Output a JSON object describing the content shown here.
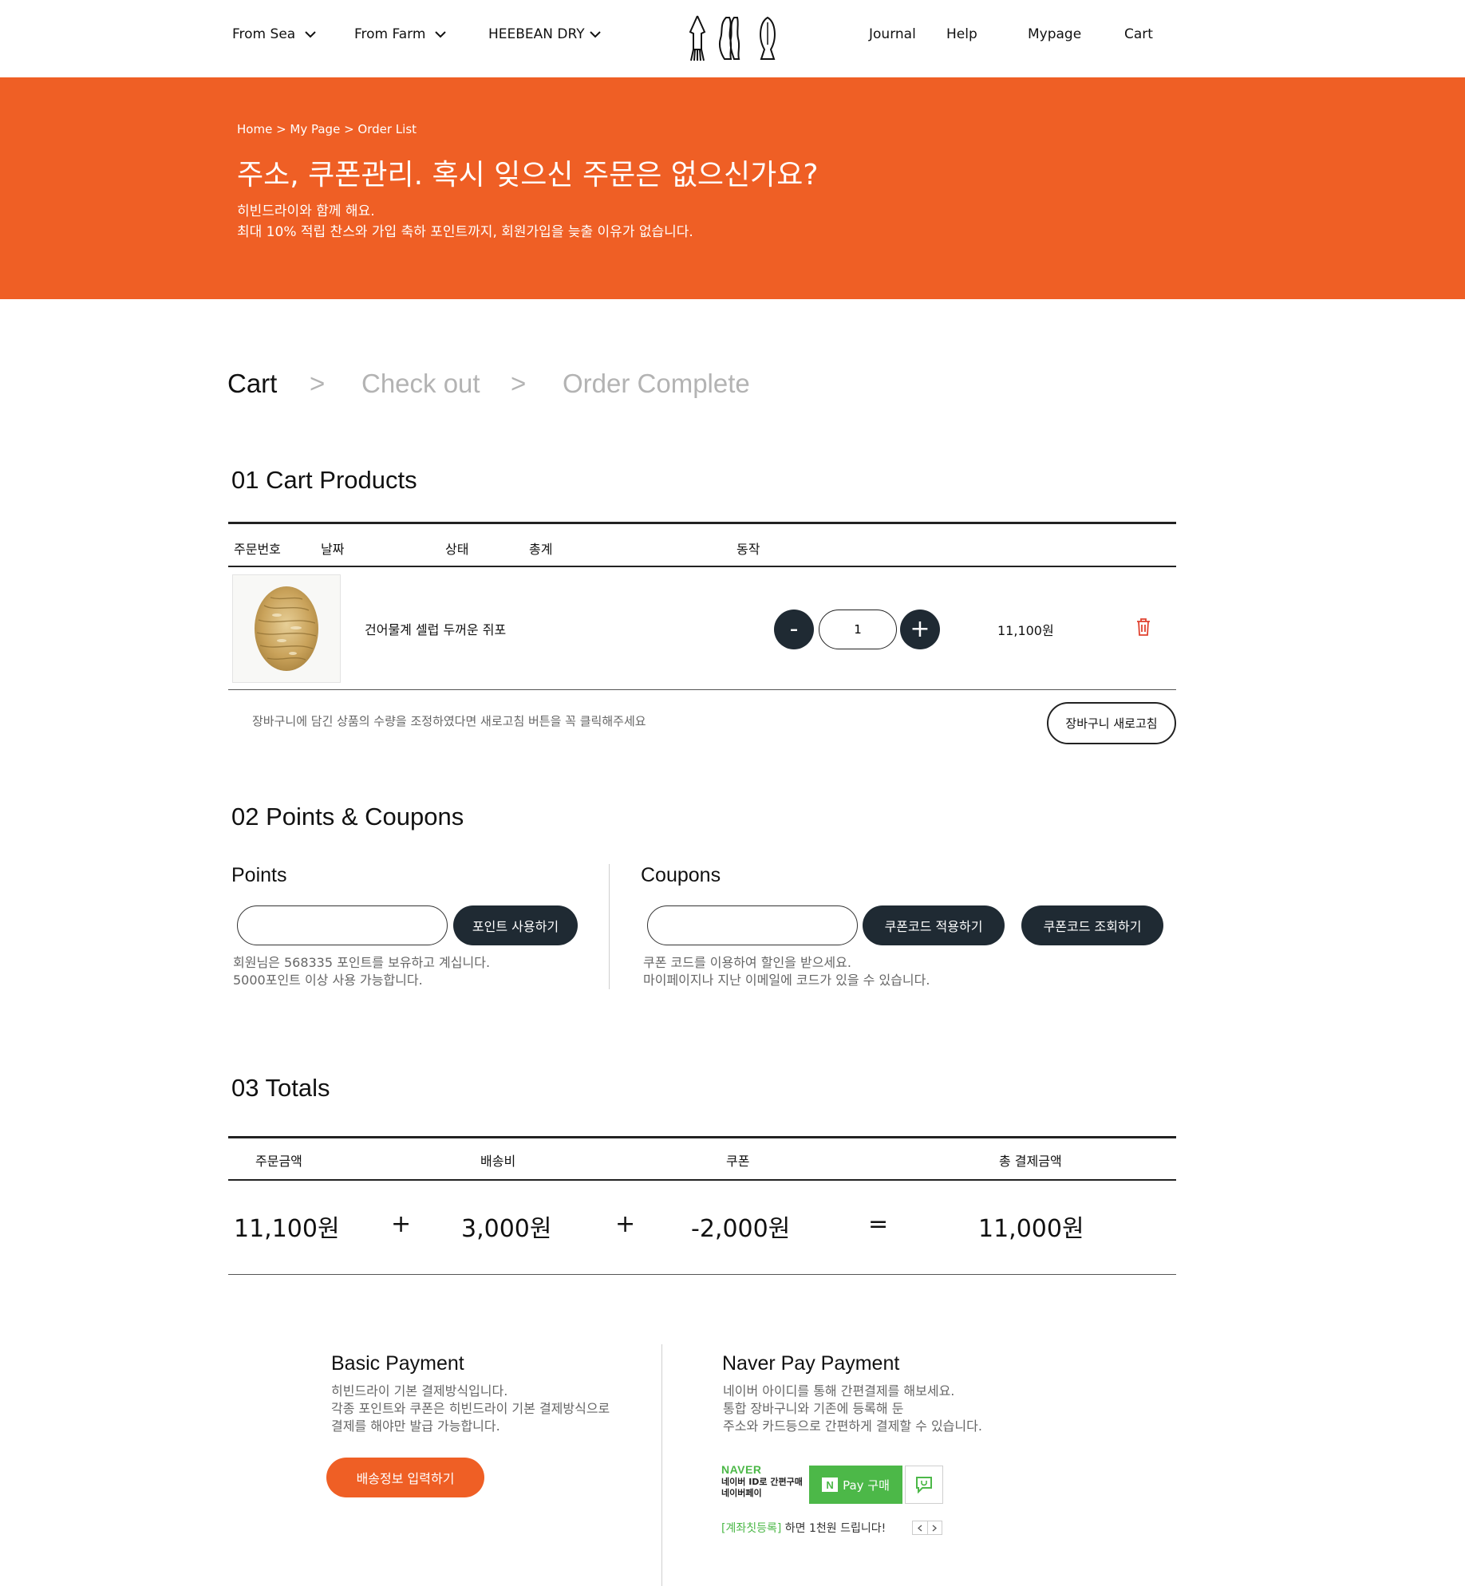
{
  "header": {
    "nav_left": [
      {
        "label": "From Sea"
      },
      {
        "label": "From Farm"
      },
      {
        "label": "HEEBEAN DRY"
      }
    ],
    "nav_right": [
      {
        "label": "Journal"
      },
      {
        "label": "Help"
      },
      {
        "label": "Mypage"
      },
      {
        "label": "Cart"
      }
    ]
  },
  "hero": {
    "breadcrumb": "Home > My Page > Order List",
    "title": "주소, 쿠폰관리. 혹시 잊으신 주문은 없으신가요?",
    "subtitle_line1": "히빈드라이와 함께 해요.",
    "subtitle_line2": "최대 10% 적립 찬스와 가입 축하 포인트까지, 회원가입을 늦출 이유가 없습니다.",
    "background_color": "#ef5f25"
  },
  "steps": {
    "items": [
      "Cart",
      "Check out",
      "Order Complete"
    ],
    "separator": ">",
    "active": "Cart"
  },
  "cart": {
    "section_title": "01 Cart Products",
    "columns": [
      "주문번호",
      "날짜",
      "상태",
      "총계",
      "동작"
    ],
    "items": [
      {
        "name": "건어물계 셀럽 두꺼운 쥐포",
        "quantity": "1",
        "price": "11,100원",
        "image_icon": "dried-filefish-image"
      }
    ],
    "qty_minus": "-",
    "qty_plus": "+",
    "refresh_note": "장바구니에 담긴 상품의 수량을 조정하였다면 새로고침 버튼을 꼭 클릭해주세요",
    "refresh_button": "장바구니 새로고침"
  },
  "points_coupons": {
    "section_title": "02 Points & Coupons",
    "points": {
      "title": "Points",
      "input_value": "",
      "use_button": "포인트 사용하기",
      "note_line1": "회원님은 568335 포인트를 보유하고 계십니다.",
      "note_line2": "5000포인트 이상 사용 가능합니다."
    },
    "coupons": {
      "title": "Coupons",
      "input_value": "",
      "apply_button": "쿠폰코드 적용하기",
      "lookup_button": "쿠폰코드 조회하기",
      "note_line1": "쿠폰 코드를 이용하여 할인을 받으세요.",
      "note_line2": "마이페이지나 지난 이메일에 코드가 있을 수 있습니다."
    }
  },
  "totals": {
    "section_title": "03 Totals",
    "columns": [
      "주문금액",
      "배송비",
      "쿠폰",
      "총 결제금액"
    ],
    "values": [
      "11,100원",
      "3,000원",
      "-2,000원",
      "11,000원"
    ],
    "operators": [
      "+",
      "+",
      "="
    ]
  },
  "payment": {
    "basic": {
      "title": "Basic Payment",
      "desc_line1": "히빈드라이 기본 결제방식입니다.",
      "desc_line2": "각종 포인트와 쿠폰은 히빈드라이 기본 결제방식으로",
      "desc_line3": "결제를 해야만 발급 가능합니다.",
      "button": "배송정보 입력하기"
    },
    "naver": {
      "title": "Naver Pay Payment",
      "desc_line1": "네이버 아이디를 통해 간편결제를 해보세요.",
      "desc_line2": "통합 장바구니와 기존에 등록해 둔",
      "desc_line3": "주소와 카드등으로 간편하게 결제할 수 있습니다.",
      "brand": "NAVER",
      "brand_line1": "네이버 ID로 간편구매",
      "brand_line2": "네이버페이",
      "pay_logo": "N",
      "pay_button": "Pay 구매",
      "promo_link": "[계좌칫등록]",
      "promo_text": "하면 1천원 드립니다!",
      "green_color": "#4cb848"
    }
  },
  "colors": {
    "accent": "#ef5f25",
    "dark_button": "#1f2a33",
    "delete_icon": "#e0412f"
  }
}
